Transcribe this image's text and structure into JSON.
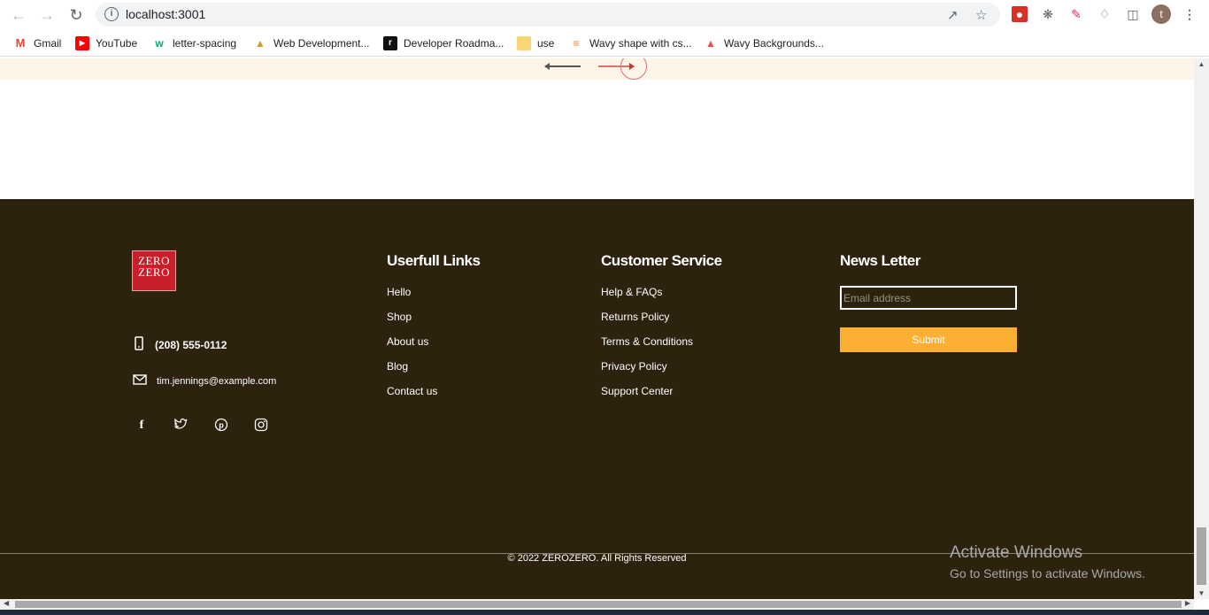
{
  "browser": {
    "url": "localhost:3001",
    "avatar_letter": "t",
    "icons": [
      "back-icon",
      "forward-icon",
      "reload-icon",
      "info-icon",
      "share-icon",
      "star-icon",
      "extensions-icon",
      "side-panel-icon",
      "menu-icon"
    ]
  },
  "bookmarks": [
    {
      "label": "Gmail",
      "icon": "gmail-icon",
      "color": "#ea4335"
    },
    {
      "label": "YouTube",
      "icon": "youtube-icon",
      "color": "#ff0000"
    },
    {
      "label": "letter-spacing",
      "icon": "w3schools-icon",
      "color": "#04aa6d"
    },
    {
      "label": "Web Development...",
      "icon": "bookmark-icon",
      "color": "#c99a2e"
    },
    {
      "label": "Developer Roadma...",
      "icon": "roadmap-icon",
      "color": "#111111"
    },
    {
      "label": "use",
      "icon": "folder-icon",
      "color": "#f7d774"
    },
    {
      "label": "Wavy shape with cs...",
      "icon": "stackoverflow-icon",
      "color": "#f48024"
    },
    {
      "label": "Wavy Backgrounds...",
      "icon": "flame-icon",
      "color": "#e94f4f"
    }
  ],
  "footer": {
    "logo_line1": "ZERO",
    "logo_line2": "ZERO",
    "phone": "(208) 555-0112",
    "email": "tim.jennings@example.com",
    "social": [
      "facebook-icon",
      "twitter-icon",
      "pinterest-icon",
      "instagram-icon"
    ],
    "useful_links": {
      "title": "Userfull Links",
      "items": [
        "Hello",
        "Shop",
        "About us",
        "Blog",
        "Contact us"
      ]
    },
    "customer_service": {
      "title": "Customer Service",
      "items": [
        "Help & FAQs",
        "Returns Policy",
        "Terms & Conditions",
        "Privacy Policy",
        "Support Center"
      ]
    },
    "newsletter": {
      "title": "News Letter",
      "placeholder": "Email address",
      "submit_label": "Submit"
    },
    "copyright": "© 2022 ZEROZERO. All Rights Reserved"
  },
  "activate_windows": {
    "title": "Activate Windows",
    "subtitle": "Go to Settings to activate Windows."
  },
  "colors": {
    "footer_bg": "#2c220e",
    "accent": "#fbb034",
    "slider_band": "#fdf6e8"
  }
}
